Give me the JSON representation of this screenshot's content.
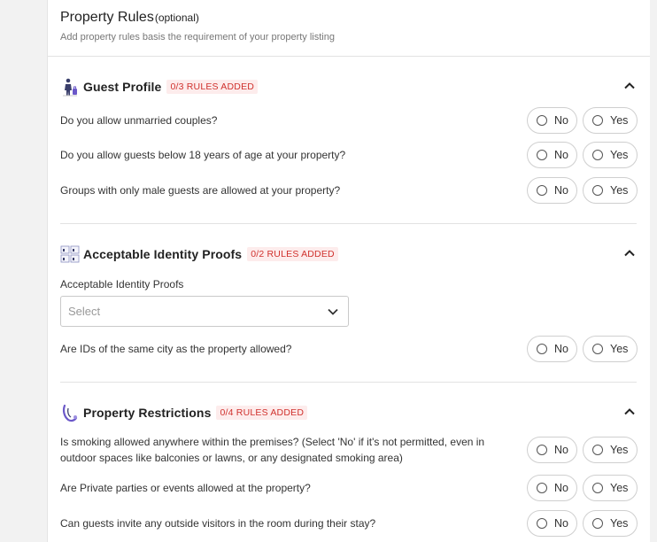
{
  "header": {
    "title": "Property Rules",
    "title_optional": "(optional)",
    "subtitle": "Add property rules basis the requirement of your property listing"
  },
  "sections": [
    {
      "title": "Guest Profile",
      "badge": "0/3 RULES ADDED",
      "icon": "guest-profile-icon",
      "questions": [
        "Do you allow unmarried couples?",
        "Do you allow guests below 18 years of age at your property?",
        "Groups with only male guests are allowed at your property?"
      ]
    },
    {
      "title": "Acceptable Identity Proofs",
      "badge": "0/2 RULES ADDED",
      "icon": "id-cards-icon",
      "field_label": "Acceptable Identity Proofs",
      "select_placeholder": "Select",
      "questions": [
        "Are IDs of the same city as the property allowed?"
      ]
    },
    {
      "title": "Property Restrictions",
      "badge": "0/4 RULES ADDED",
      "icon": "property-restrictions-icon",
      "questions": [
        "Is smoking allowed anywhere within the premises? (Select 'No' if it's not permitted, even in outdoor spaces like balconies or lawns, or any designated smoking area)",
        "Are Private parties or events allowed at the property?",
        "Can guests invite any outside visitors in the room during their stay?"
      ]
    }
  ],
  "options": {
    "no": "No",
    "yes": "Yes"
  },
  "colors": {
    "badge_text": "#d0312d",
    "badge_bg": "#fdecec",
    "border": "#cfcfcf"
  }
}
